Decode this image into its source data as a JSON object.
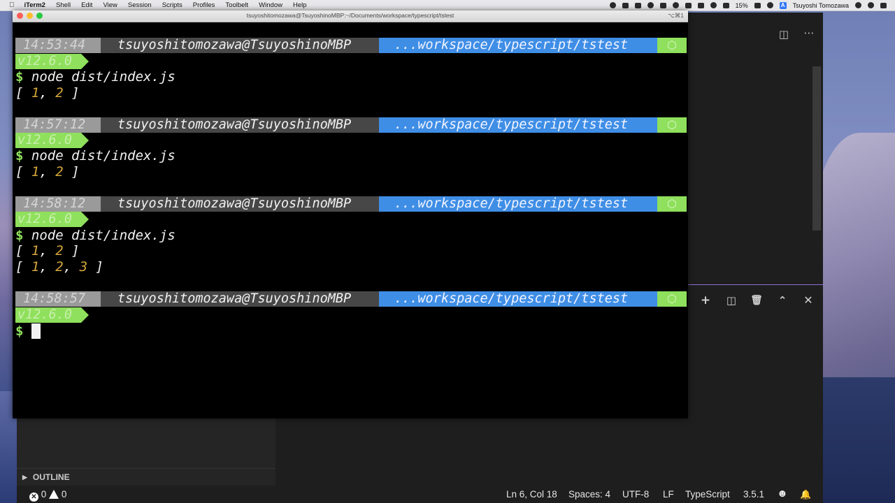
{
  "menubar": {
    "app": "iTerm2",
    "items": [
      "Shell",
      "Edit",
      "View",
      "Session",
      "Scripts",
      "Profiles",
      "Toolbelt",
      "Window",
      "Help"
    ],
    "battery": "15%",
    "user": "Tsuyoshi Tomozawa"
  },
  "iterm": {
    "title": "tsuyoshitomozawa@TsuyoshinoMBP:~/Documents/workspace/typescript/tstest",
    "shortcut": "⌥⌘1"
  },
  "prompt": {
    "user": "tsuyoshitomozawa@TsuyoshinoMBP",
    "path": "...workspace/typescript/tstest",
    "node": "v12.6.0",
    "hex_icon": "⬡"
  },
  "blocks": [
    {
      "time": "14:53:44",
      "command": "node dist/index.js",
      "output": [
        "[ 1, 2 ]"
      ]
    },
    {
      "time": "14:57:12",
      "command": "node dist/index.js",
      "output": [
        "[ 1, 2 ]"
      ]
    },
    {
      "time": "14:58:12",
      "command": "node dist/index.js",
      "output": [
        "[ 1, 2 ]",
        "[ 1, 2, 3 ]"
      ]
    },
    {
      "time": "14:58:57",
      "command": "",
      "output": []
    }
  ],
  "vscode": {
    "outline_label": "OUTLINE",
    "status": {
      "errors": "0",
      "warnings": "0",
      "position": "Ln 6, Col 18",
      "spaces": "Spaces: 4",
      "encoding": "UTF-8",
      "eol": "LF",
      "language": "TypeScript",
      "version": "3.5.1"
    }
  },
  "colors": {
    "time_segment": "#9a9a9a",
    "user_segment": "#474747",
    "path_segment": "#3f8ee6",
    "node_segment": "#8fe05c",
    "number": "#d5a73b",
    "panel_border": "#8f6fd8"
  }
}
